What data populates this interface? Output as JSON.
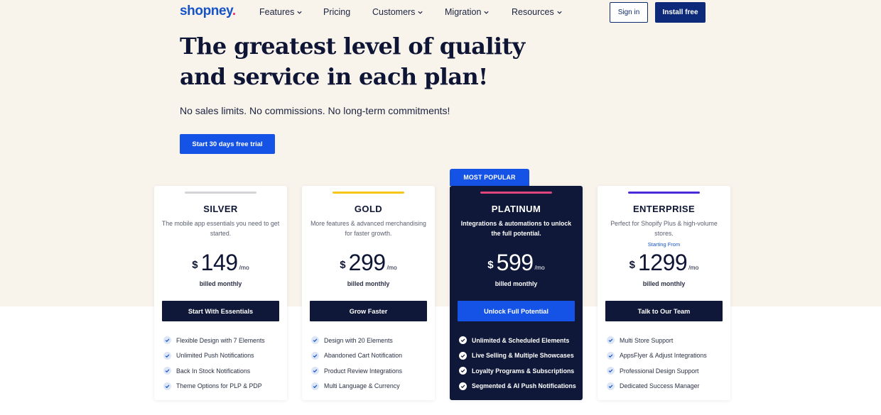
{
  "nav": {
    "logo_main": "shopney",
    "logo_dot": ".",
    "items": [
      {
        "label": "Features",
        "has_dropdown": true
      },
      {
        "label": "Pricing",
        "has_dropdown": false
      },
      {
        "label": "Customers",
        "has_dropdown": true
      },
      {
        "label": "Migration",
        "has_dropdown": true
      },
      {
        "label": "Resources",
        "has_dropdown": true
      }
    ],
    "signin_label": "Sign in",
    "install_label": "Install free"
  },
  "hero": {
    "title": "The greatest level of quality and service in each plan!",
    "subtitle": "No sales limits. No commissions. No long-term commitments!",
    "cta_label": "Start 30 days free trial"
  },
  "badge": "MOST POPULAR",
  "plans": [
    {
      "name": "SILVER",
      "accent": "#d4d4d8",
      "desc": "The mobile app essentials you need to get started.",
      "starting": "",
      "currency": "$",
      "price": "149",
      "period": "/mo",
      "billed": "billed monthly",
      "cta": "Start With Essentials",
      "features": [
        "Flexible Design with 7 Elements",
        "Unlimited Push Notifications",
        "Back In Stock Notifications",
        "Theme Options for PLP & PDP"
      ]
    },
    {
      "name": "GOLD",
      "accent": "#f5c518",
      "desc": "More features & advanced merchandising for faster growth.",
      "starting": "",
      "currency": "$",
      "price": "299",
      "period": "/mo",
      "billed": "billed monthly",
      "cta": "Grow Faster",
      "features": [
        "Design with 20 Elements",
        "Abandoned Cart Notification",
        "Product Review Integrations",
        "Multi Language & Currency"
      ]
    },
    {
      "name": "PLATINUM",
      "accent": "#e0457b",
      "desc": "Integrations & automations to unlock the full potential.",
      "starting": "",
      "currency": "$",
      "price": "599",
      "period": "/mo",
      "billed": "billed monthly",
      "cta": "Unlock Full Potential",
      "features": [
        "Unlimited & Scheduled Elements",
        "Live Selling & Multiple Showcases",
        "Loyalty Programs & Subscriptions",
        "Segmented & AI Push Notifications"
      ]
    },
    {
      "name": "ENTERPRISE",
      "accent": "#4b2bd8",
      "desc": "Perfect for Shopify Plus & high-volume stores.",
      "starting": "Starting From",
      "currency": "$",
      "price": "1299",
      "period": "/mo",
      "billed": "billed monthly",
      "cta": "Talk to Our Team",
      "features": [
        "Multi Store Support",
        "AppsFlyer & Adjust Integrations",
        "Professional Design Support",
        "Dedicated Success Manager"
      ]
    }
  ]
}
